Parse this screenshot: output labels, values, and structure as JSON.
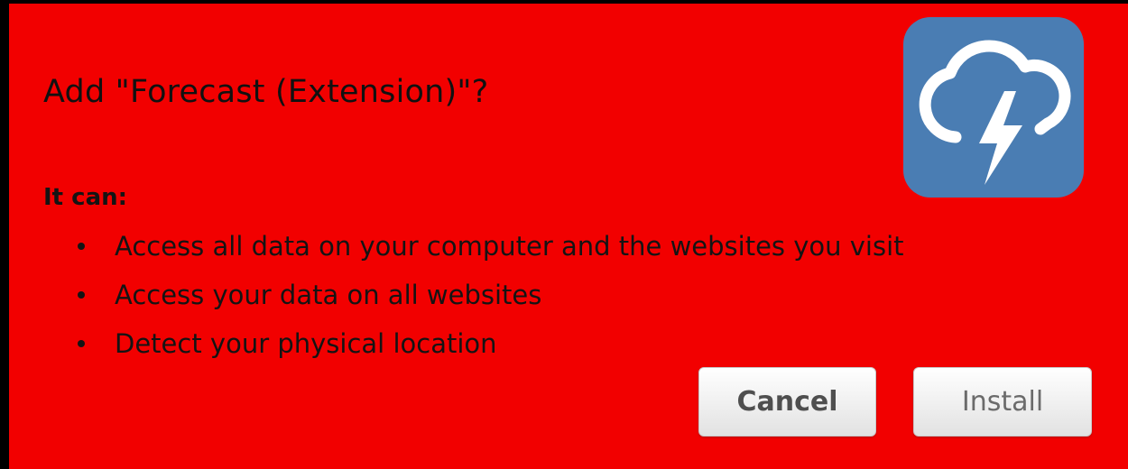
{
  "dialog": {
    "title": "Add \"Forecast (Extension)\"?",
    "subtitle": "It can:",
    "permissions": [
      "Access all data on your computer and the websites you visit",
      "Access your data on all websites",
      "Detect your physical location"
    ],
    "cancel_label": "Cancel",
    "install_label": "Install"
  },
  "icons": {
    "app_icon": "cloud-lightning-icon"
  },
  "colors": {
    "background": "#f20000",
    "icon_background": "#4a7db3",
    "outer": "#000000"
  }
}
